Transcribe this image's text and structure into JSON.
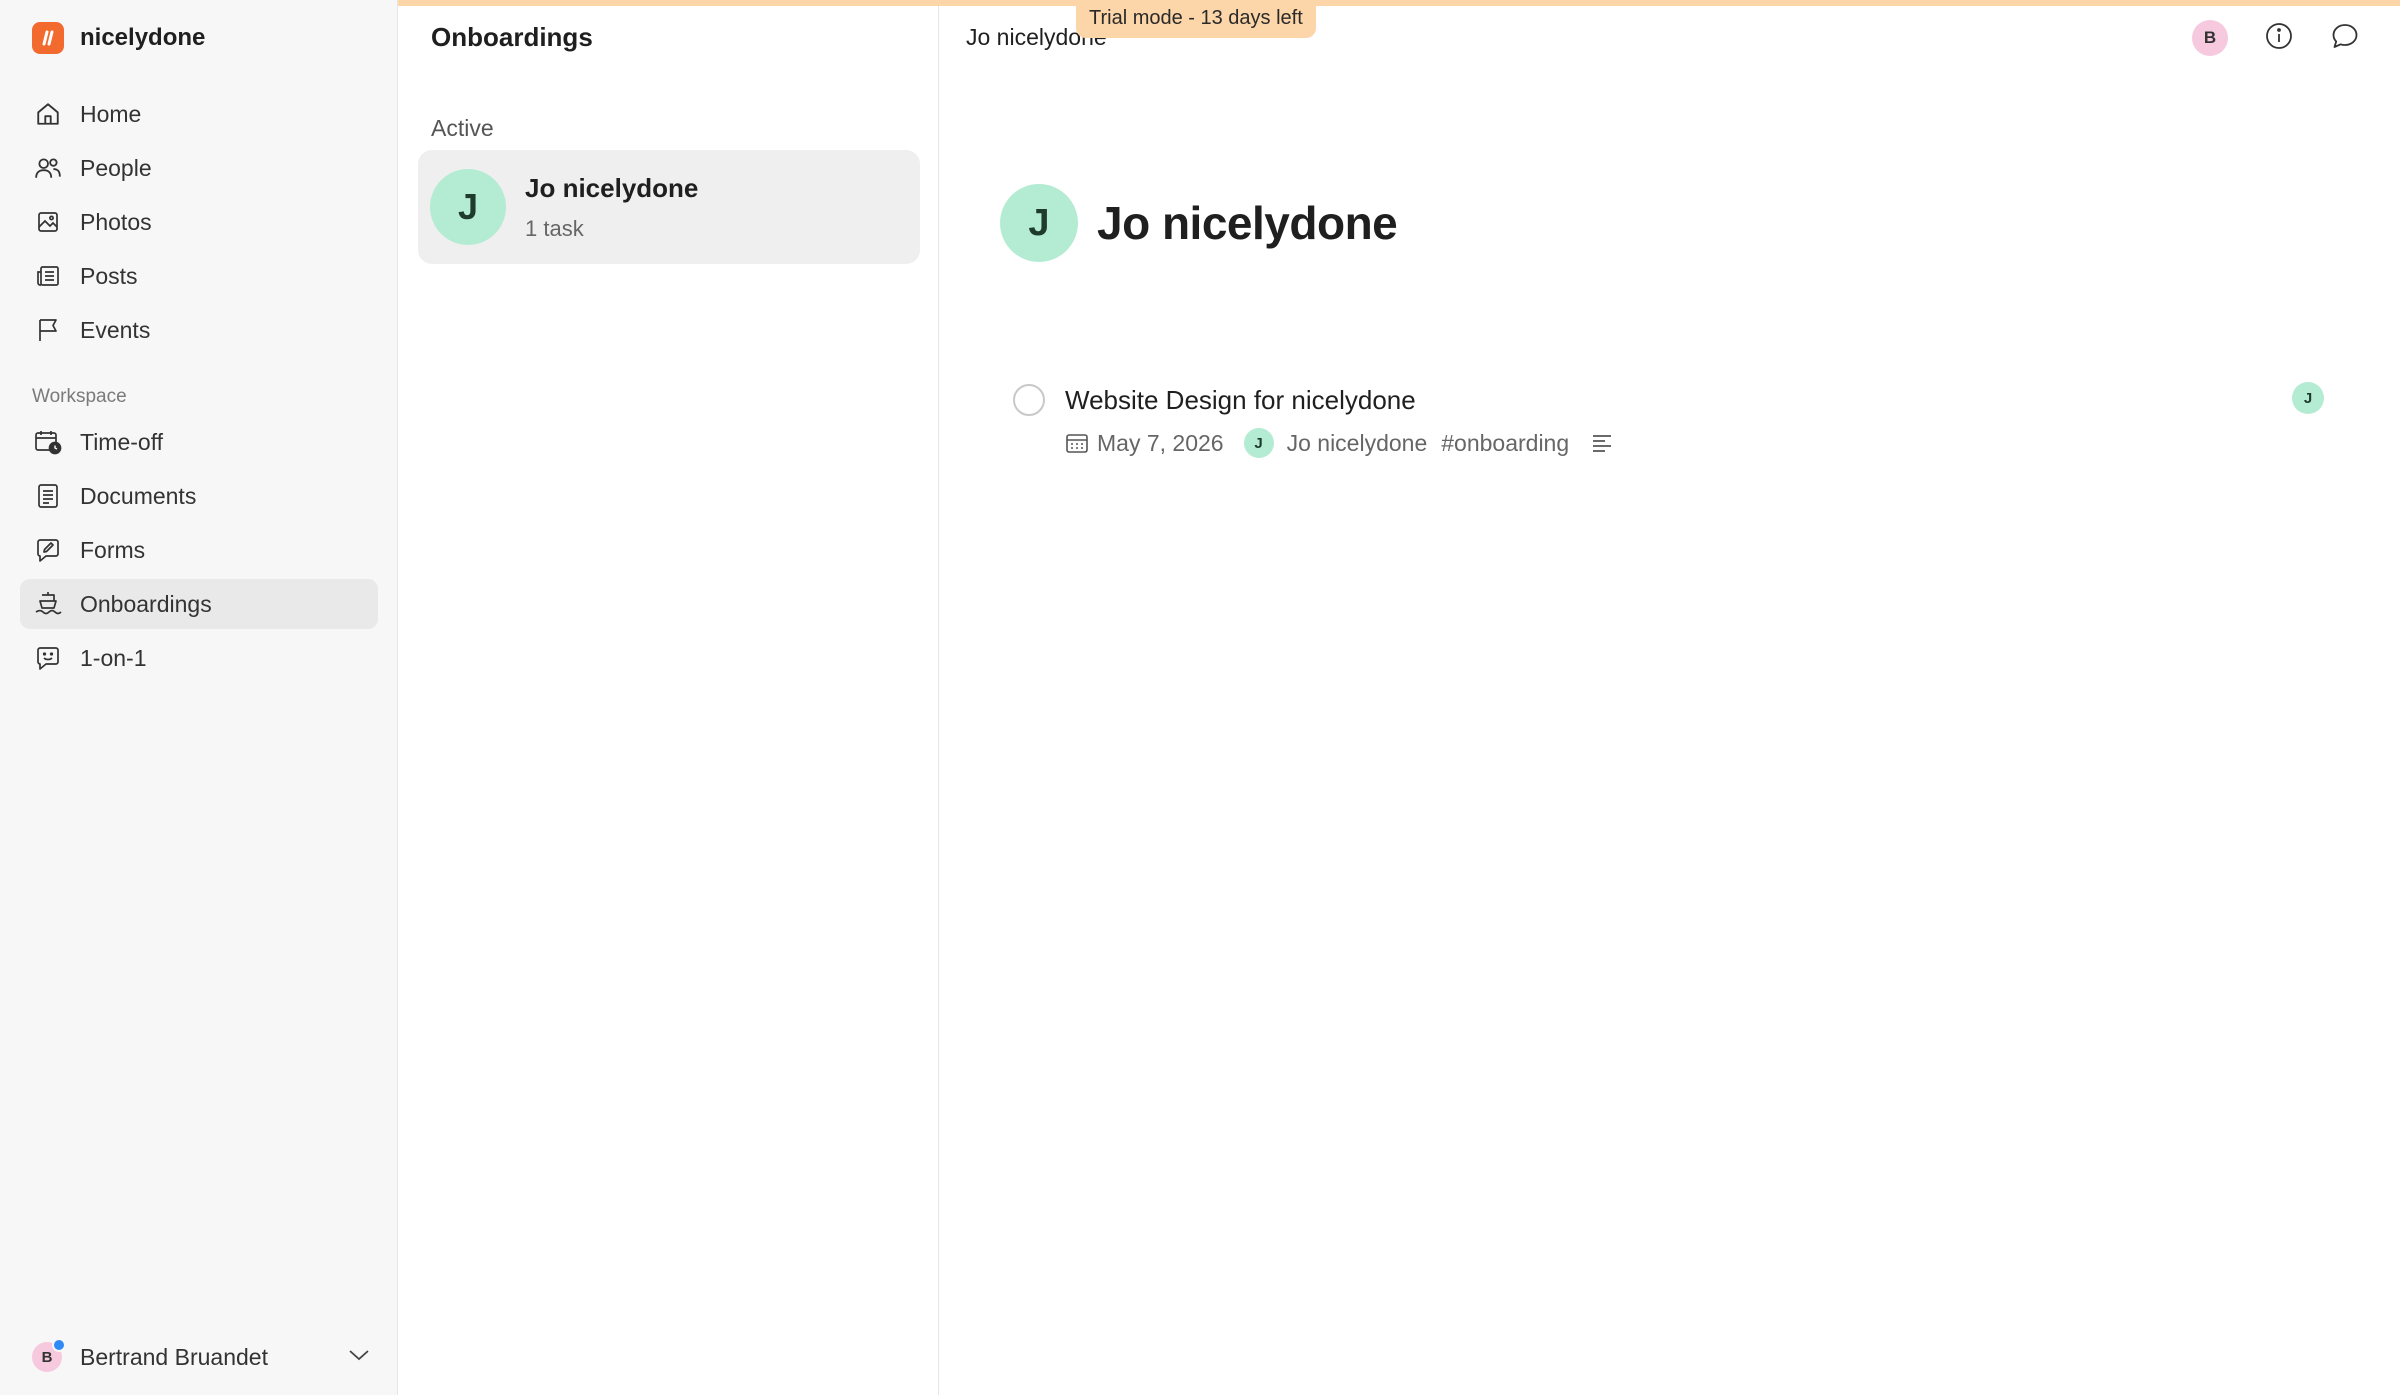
{
  "trial": {
    "label": "Trial mode - 13 days left"
  },
  "brand": {
    "name": "nicelydone",
    "logo_icon": "brand-logo-icon",
    "accent": "#f26a2e"
  },
  "sidebar": {
    "items": [
      {
        "label": "Home",
        "icon": "home-icon"
      },
      {
        "label": "People",
        "icon": "people-icon"
      },
      {
        "label": "Photos",
        "icon": "photo-icon"
      },
      {
        "label": "Posts",
        "icon": "newspaper-icon"
      },
      {
        "label": "Events",
        "icon": "flag-icon"
      }
    ],
    "workspace_label": "Workspace",
    "workspace_items": [
      {
        "label": "Time-off",
        "icon": "calendar-clock-icon"
      },
      {
        "label": "Documents",
        "icon": "document-icon"
      },
      {
        "label": "Forms",
        "icon": "form-icon"
      },
      {
        "label": "Onboardings",
        "icon": "boat-icon",
        "active": true
      },
      {
        "label": "1-on-1",
        "icon": "chat-face-icon"
      }
    ],
    "user": {
      "initial": "B",
      "name": "Bertrand Bruandet"
    }
  },
  "list": {
    "title": "Onboardings",
    "section": "Active",
    "items": [
      {
        "initial": "J",
        "name": "Jo nicelydone",
        "subtitle": "1 task"
      }
    ]
  },
  "detail": {
    "top_title": "Jo nicelydone",
    "top_avatar_initial": "B",
    "hero": {
      "initial": "J",
      "name": "Jo nicelydone"
    },
    "task": {
      "title": "Website Design for nicelydone",
      "date": "May 7, 2026",
      "assignee_initial": "J",
      "assignee_name": "Jo nicelydone",
      "tag": "#onboarding",
      "right_avatar_initial": "J"
    }
  }
}
